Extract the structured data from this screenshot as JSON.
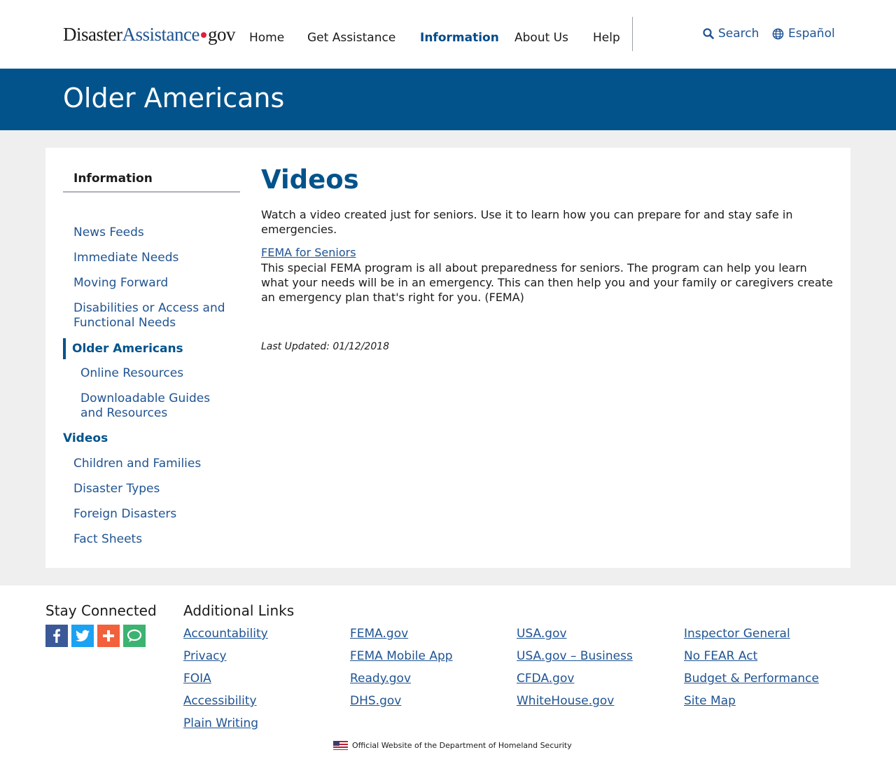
{
  "header": {
    "logo": {
      "part1": "Disaster",
      "part2": "Assistance",
      "part3": "gov"
    },
    "nav": [
      "Home",
      "Get Assistance",
      "Information",
      "About Us",
      "Help"
    ],
    "active_nav": "Information",
    "search_label": "Search",
    "language_label": "Español"
  },
  "banner": {
    "title": "Older Americans"
  },
  "sidebar": {
    "heading": "Information",
    "items": [
      {
        "label": "News Feeds"
      },
      {
        "label": "Immediate Needs"
      },
      {
        "label": "Moving Forward"
      },
      {
        "label": "Disabilities or Access and Functional Needs"
      },
      {
        "label": "Older Americans"
      },
      {
        "label": "Online Resources"
      },
      {
        "label": "Downloadable Guides and Resources"
      },
      {
        "label": "Videos"
      },
      {
        "label": "Children and Families"
      },
      {
        "label": "Disaster Types"
      },
      {
        "label": "Foreign Disasters"
      },
      {
        "label": "Fact Sheets"
      }
    ]
  },
  "main": {
    "title": "Videos",
    "intro": "Watch a video created just for seniors. Use it to learn how you can prepare for and stay safe in emergencies.",
    "video_link": "FEMA for Seniors",
    "video_desc": "This special FEMA program is all about preparedness for seniors. The program can help you learn what your needs will be in an emergency. This can then help you and your family or caregivers create an emergency plan that's right for you. (FEMA)",
    "last_updated": "Last Updated: 01/12/2018"
  },
  "footer": {
    "stay_connected": "Stay Connected",
    "social": [
      "facebook-icon",
      "twitter-icon",
      "google-plus-icon",
      "chat-icon"
    ],
    "social_colors": [
      "#3b5998",
      "#1da1f2",
      "#f2603c",
      "#3cb371"
    ],
    "additional_links_heading": "Additional Links",
    "columns": [
      [
        "Accountability",
        "Privacy",
        "FOIA",
        "Accessibility",
        "Plain Writing"
      ],
      [
        "FEMA.gov",
        "FEMA Mobile App",
        "Ready.gov",
        "DHS.gov"
      ],
      [
        "USA.gov",
        "USA.gov – Business",
        "CFDA.gov",
        "WhiteHouse.gov"
      ],
      [
        "Inspector General",
        "No FEAR Act",
        "Budget & Performance",
        "Site Map"
      ]
    ],
    "official": "Official Website of the Department of Homeland Security"
  },
  "colors": {
    "primary": "#02538b",
    "link": "#205493",
    "accent_red": "#e31c3d"
  }
}
